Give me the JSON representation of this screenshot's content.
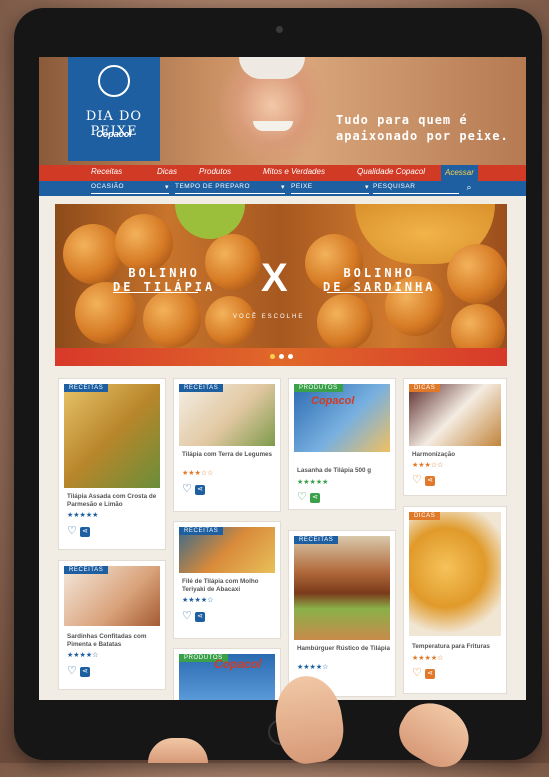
{
  "logo": {
    "title": "DIA DO PEIXE",
    "brand": "Copacol"
  },
  "hero": {
    "tagline": "Tudo para quem é apaixonado por peixe."
  },
  "nav": {
    "items": [
      "Receitas",
      "Dicas",
      "Produtos",
      "Mitos e Verdades",
      "Qualidade Copacol",
      "Acessar"
    ]
  },
  "filters": {
    "occasion": "OCASIÃO",
    "prep_time": "TEMPO DE PREPARO",
    "fish": "PEIXE",
    "search_placeholder": "PESQUISAR"
  },
  "banner": {
    "left_line1": "BOLINHO",
    "left_line2": "DE TILÁPIA",
    "x": "X",
    "right_line1": "BOLINHO",
    "right_line2": "DE SARDINHA",
    "subtitle": "VOCÊ ESCOLHE"
  },
  "cards": [
    {
      "badge": "RECEITAS",
      "title": "Tilápia Assada com Crosta de Parmesão e Limão",
      "stars": "★★★★★"
    },
    {
      "badge": "RECEITAS",
      "title": "Tilápia com Terra de Legumes",
      "stars": "★★★☆☆"
    },
    {
      "badge": "PRODUTOS",
      "title": "Lasanha de Tilápia 500 g",
      "stars": "★★★★★"
    },
    {
      "badge": "DICAS",
      "title": "Harmonização",
      "stars": "★★★☆☆"
    },
    {
      "badge": "RECEITAS",
      "title": "Filé de Tilápia com Molho Teriyaki de Abacaxi",
      "stars": "★★★★☆"
    },
    {
      "badge": "RECEITAS",
      "title": "Hambúrguer Rústico de Tilápia",
      "stars": "★★★★☆"
    },
    {
      "badge": "DICAS",
      "title": "Temperatura para Frituras",
      "stars": "★★★★☆"
    },
    {
      "badge": "RECEITAS",
      "title": "Sardinhas Confitadas com Pimenta e Batatas",
      "stars": "★★★★☆"
    },
    {
      "badge": "PRODUTOS",
      "title": "",
      "stars": "",
      "brand": "Copacol"
    }
  ],
  "colors": {
    "blue": "#1d5fa0",
    "red": "#d13b25",
    "orange": "#e07a2a",
    "green": "#3aa04a"
  }
}
